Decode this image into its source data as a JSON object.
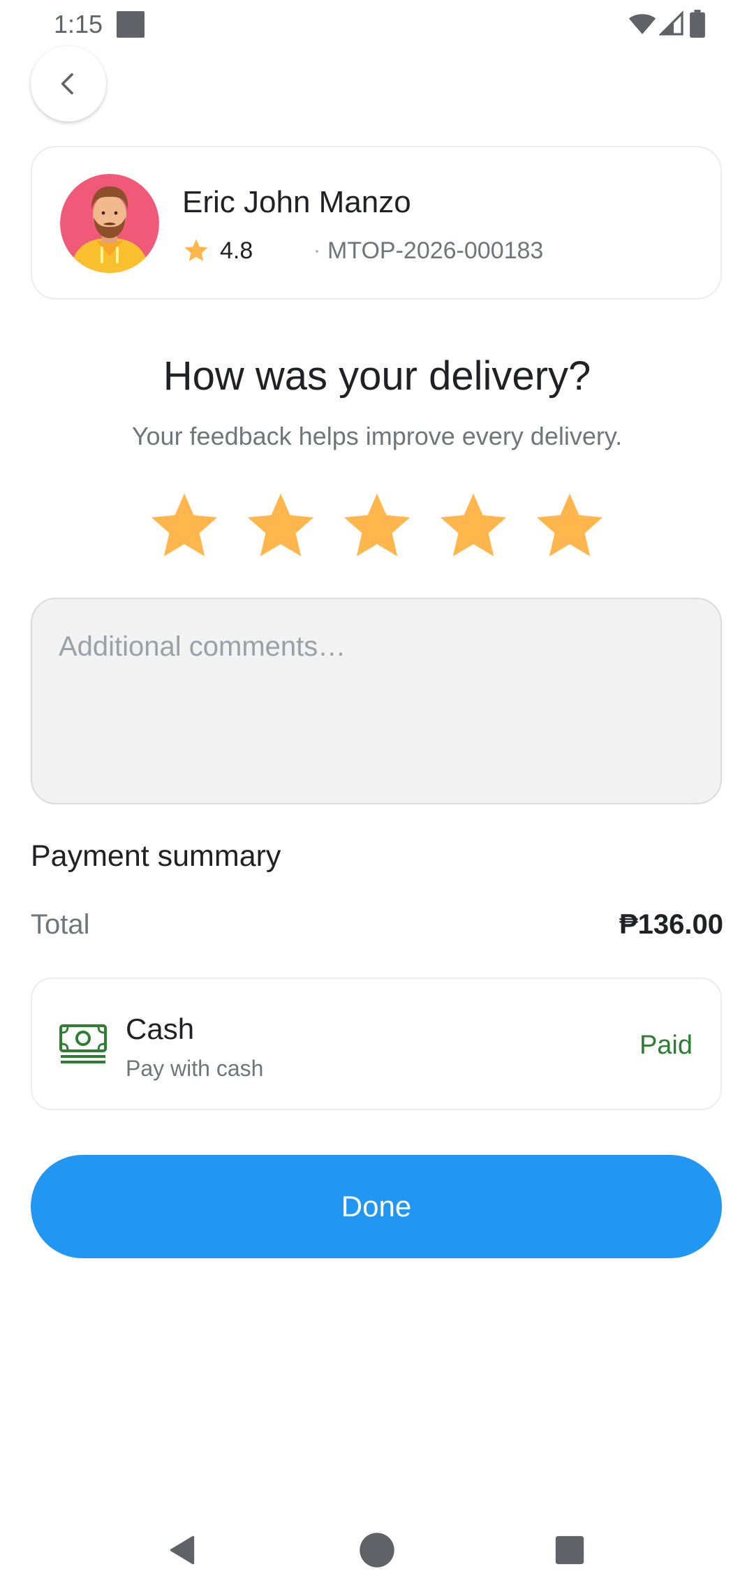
{
  "status_bar": {
    "time": "1:15",
    "icons": [
      "wifi-icon",
      "signal-icon",
      "battery-icon"
    ]
  },
  "back": {
    "icon": "chevron-left-icon"
  },
  "driver": {
    "name": "Eric John Manzo",
    "rating": "4.8",
    "separator": "·",
    "id": "MTOP-2026-000183"
  },
  "feedback": {
    "title": "How was your delivery?",
    "subtitle": "Your feedback helps improve every delivery.",
    "rating": {
      "value": 5,
      "max": 5
    },
    "comments_placeholder": "Additional comments…",
    "comments_value": ""
  },
  "payment": {
    "title": "Payment summary",
    "total_label": "Total",
    "total_value": "₱136.00",
    "method": {
      "title": "Cash",
      "subtitle": "Pay with cash",
      "status": "Paid",
      "icon": "cash-icon"
    }
  },
  "actions": {
    "done_label": "Done"
  },
  "colors": {
    "primary": "#2196f3",
    "star": "#ffb74d",
    "paid": "#2e7d32",
    "cash_icon": "#2e7d32",
    "avatar_bg": "#f05a78"
  },
  "nav": {
    "buttons": [
      "back-nav-icon",
      "home-nav-icon",
      "recents-nav-icon"
    ]
  }
}
